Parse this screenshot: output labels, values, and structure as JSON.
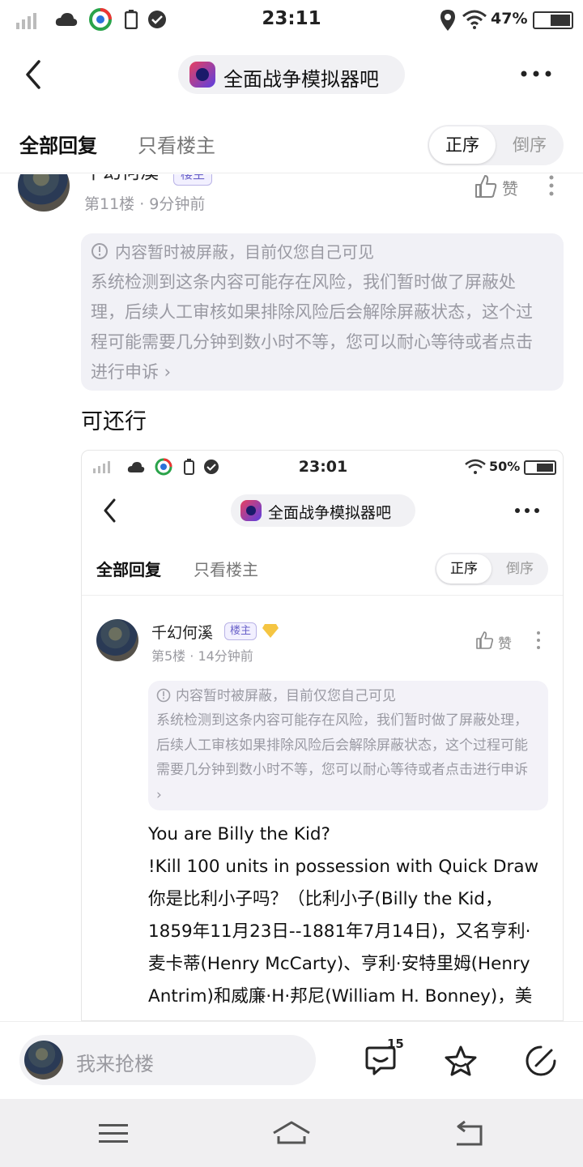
{
  "status_bar": {
    "time": "23:11",
    "battery": "47%"
  },
  "header": {
    "forum_name": "全面战争模拟器吧"
  },
  "tabs": {
    "all": "全部回复",
    "owner_only": "只看楼主",
    "order_asc": "正序",
    "order_desc": "倒序"
  },
  "post": {
    "username": "千幻何溪",
    "owner_badge": "楼主",
    "meta": "第11楼 · 9分钟前",
    "like_label": "赞",
    "notice_title": "内容暂时被屏蔽，目前仅您自己可见",
    "notice_body": "系统检测到这条内容可能存在风险，我们暂时做了屏蔽处理，后续人工审核如果排除风险后会解除屏蔽状态，这个过程可能需要几分钟到数小时不等，您可以耐心等待或者点击进行申诉",
    "body_text": "可还行"
  },
  "embedded_screenshot": {
    "status_bar": {
      "time": "23:01",
      "battery": "50%"
    },
    "forum_name": "全面战争模拟器吧",
    "tabs": {
      "all": "全部回复",
      "owner_only": "只看楼主",
      "order_asc": "正序",
      "order_desc": "倒序"
    },
    "username": "千幻何溪",
    "owner_badge": "楼主",
    "meta": "第5楼 · 14分钟前",
    "like_label": "赞",
    "notice_title": "内容暂时被屏蔽，目前仅您自己可见",
    "notice_body": "系统检测到这条内容可能存在风险，我们暂时做了屏蔽处理，后续人工审核如果排除风险后会解除屏蔽状态，这个过程可能需要几分钟到数小时不等，您可以耐心等待或者点击进行申诉",
    "text_lines": [
      "You are Billy the Kid?",
      "!Kill 100 units in possession with Quick Draw",
      "你是比利小子吗？（比利小子(Billy the Kid，",
      "1859年11月23日--1881年7月14日)，又名亨利·",
      "麦卡蒂(Henry McCarty)、亨利·安特里姆(Henry",
      "Antrim)和威廉·H·邦尼(William H. Bonney)，美"
    ]
  },
  "bottom_bar": {
    "reply_placeholder": "我来抢楼",
    "comment_count": "15"
  },
  "colors": {
    "accent": "#6a62c9",
    "notice_bg": "#f1f1f6",
    "muted": "#9a9aa3"
  }
}
